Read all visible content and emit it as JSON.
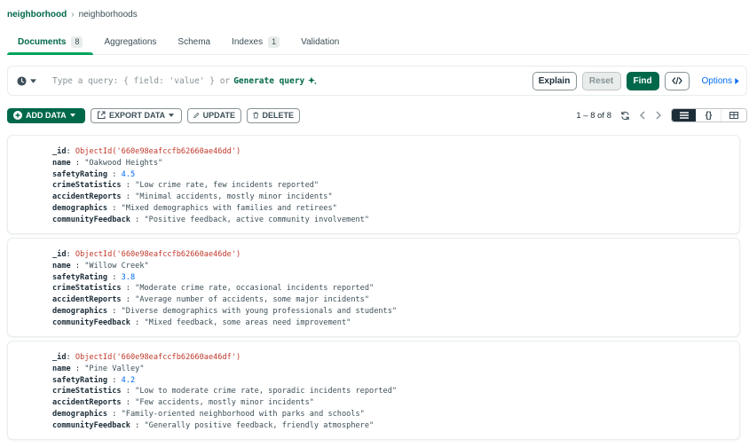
{
  "breadcrumb": {
    "database": "neighborhood",
    "collection": "neighborhoods"
  },
  "tabs": [
    {
      "label": "Documents",
      "badge": "8"
    },
    {
      "label": "Aggregations"
    },
    {
      "label": "Schema"
    },
    {
      "label": "Indexes",
      "badge": "1"
    },
    {
      "label": "Validation"
    }
  ],
  "query": {
    "placeholder": "Type a query: { field: 'value' } or",
    "generate_label": "Generate query",
    "explain_label": "Explain",
    "reset_label": "Reset",
    "find_label": "Find",
    "options_label": "Options"
  },
  "toolbar": {
    "add_data": "ADD DATA",
    "export_data": "EXPORT DATA",
    "update": "UPDATE",
    "delete": "DELETE",
    "count": "1 – 8 of 8"
  },
  "documents": [
    {
      "oid": "660e98eafccfb62660ae46dd",
      "name": "\"Oakwood Heights\"",
      "safetyRating": "4.5",
      "crimeStatistics": "\"Low crime rate, few incidents reported\"",
      "accidentReports": "\"Minimal accidents, mostly minor incidents\"",
      "demographics": "\"Mixed demographics with families and retirees\"",
      "communityFeedback": "\"Positive feedback, active community involvement\""
    },
    {
      "oid": "660e98eafccfb62660ae46de",
      "name": "\"Willow Creek\"",
      "safetyRating": "3.8",
      "crimeStatistics": "\"Moderate crime rate, occasional incidents reported\"",
      "accidentReports": "\"Average number of accidents, some major incidents\"",
      "demographics": "\"Diverse demographics with young professionals and students\"",
      "communityFeedback": "\"Mixed feedback, some areas need improvement\""
    },
    {
      "oid": "660e98eafccfb62660ae46df",
      "name": "\"Pine Valley\"",
      "safetyRating": "4.2",
      "crimeStatistics": "\"Low to moderate crime rate, sporadic incidents reported\"",
      "accidentReports": "\"Few accidents, mostly minor incidents\"",
      "demographics": "\"Family-oriented neighborhood with parks and schools\"",
      "communityFeedback": "\"Generally positive feedback, friendly atmosphere\""
    }
  ],
  "colors": {
    "brand_green": "#00684a",
    "accent_green": "#00a35c",
    "link_blue": "#016bf8",
    "oid_red": "#c0392b"
  }
}
